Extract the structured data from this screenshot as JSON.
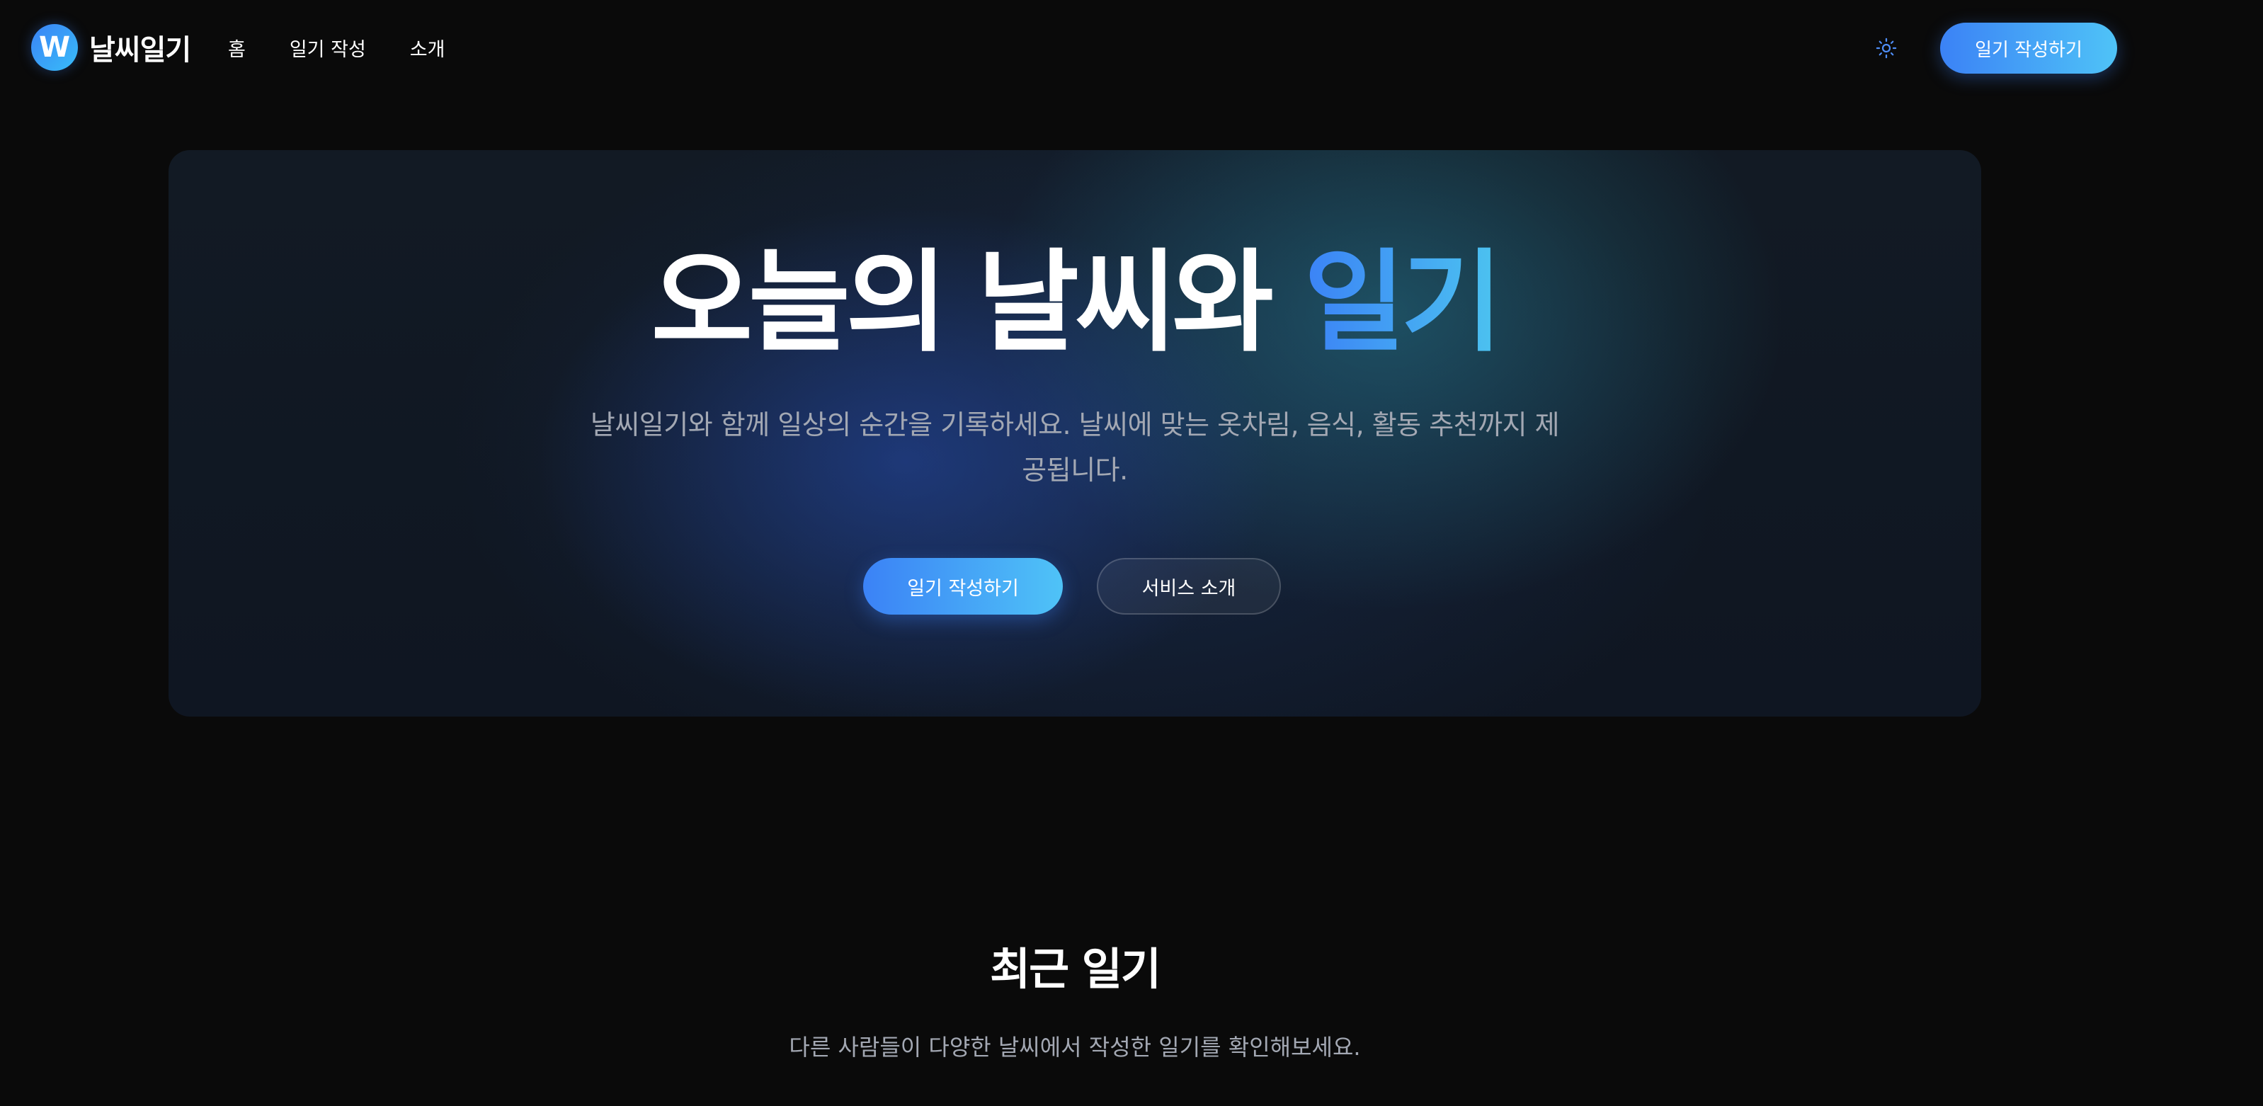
{
  "header": {
    "logo_mark": "W",
    "logo_text": "날씨일기",
    "nav": [
      "홈",
      "일기 작성",
      "소개"
    ],
    "theme_icon": "sun-icon",
    "cta_label": "일기 작성하기"
  },
  "hero": {
    "title_main": "오늘의 날씨와 ",
    "title_accent": "일기",
    "subtitle": "날씨일기와 함께 일상의 순간을 기록하세요. 날씨에 맞는 옷차림, 음식, 활동 추천까지 제공됩니다.",
    "primary_button": "일기 작성하기",
    "secondary_button": "서비스 소개"
  },
  "recent": {
    "title": "최근 일기",
    "subtitle": "다른 사람들이 다양한 날씨에서 작성한 일기를 확인해보세요."
  },
  "colors": {
    "background": "#0a0a0a",
    "accent_start": "#3b82f6",
    "accent_end": "#4fc3f7",
    "muted_text": "#a3a8b3"
  }
}
